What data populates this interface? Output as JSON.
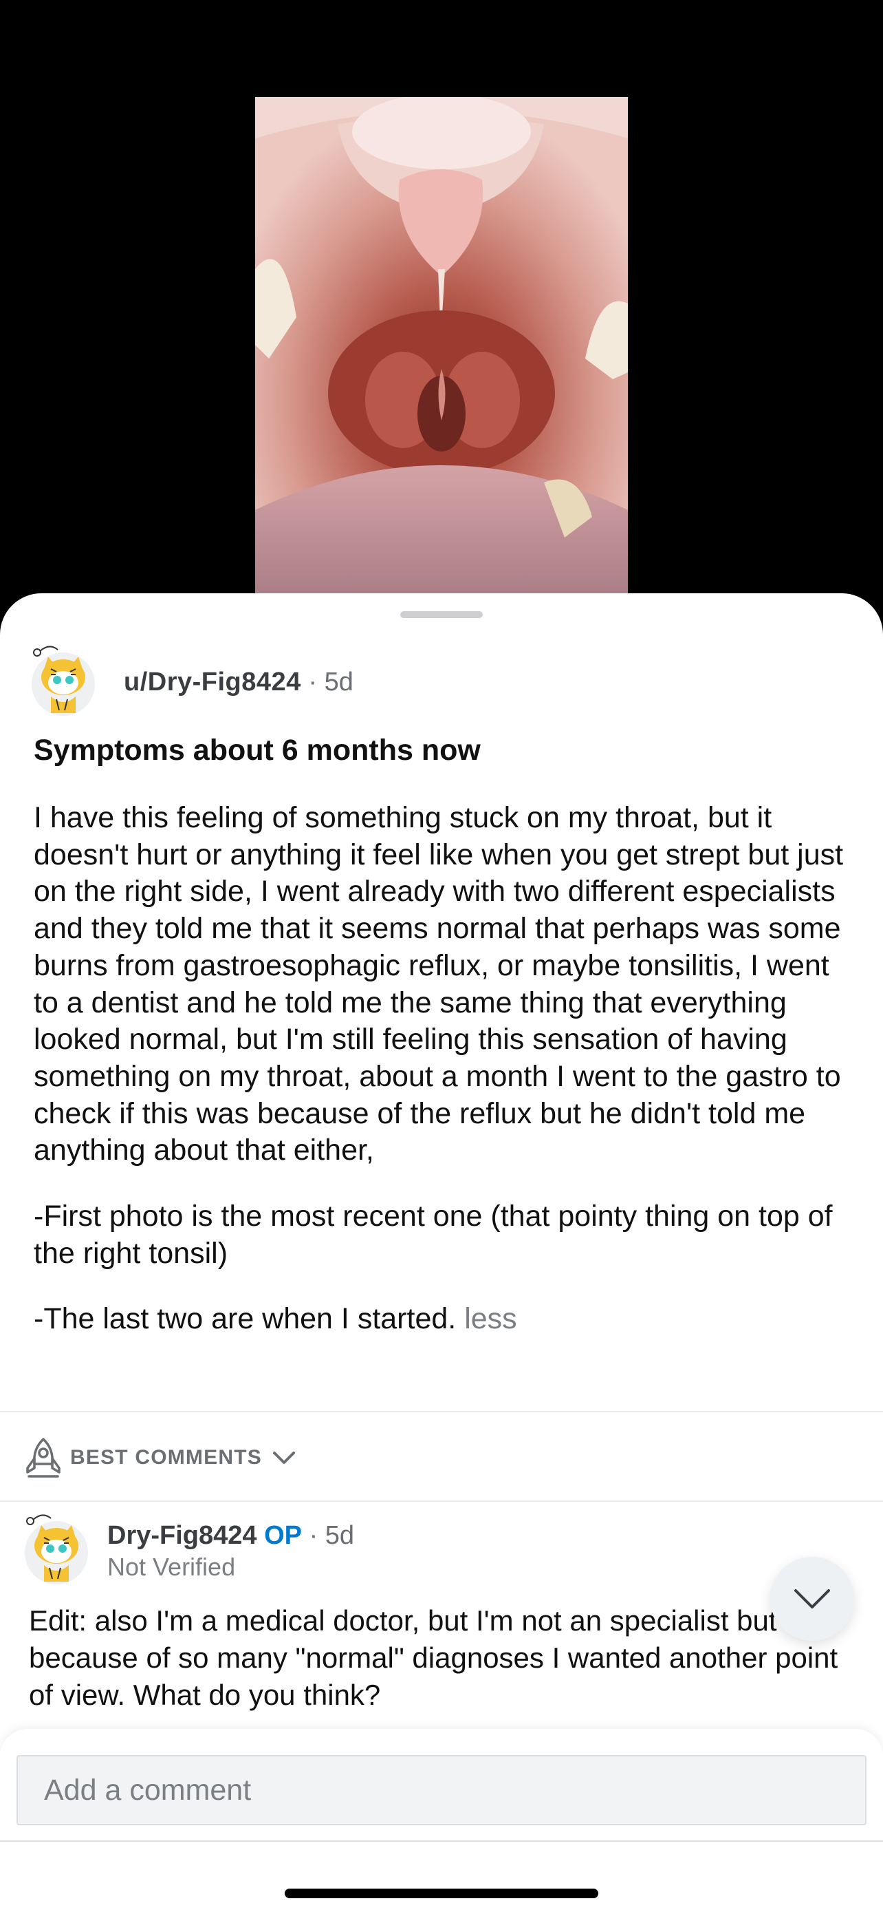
{
  "post": {
    "author": "u/Dry-Fig8424",
    "separator": "·",
    "age": "5d",
    "title": "Symptoms about 6 months now",
    "body_p1": "I have this feeling of something stuck on my throat, but it doesn't hurt or anything it feel like when you get strept but just on the right side, I went already with two different especialists and they told me that it seems normal that perhaps was some burns from gastroesophagic reflux, or maybe tonsilitis, I went to a dentist and he told me the same thing that everything looked normal, but I'm still feeling this sensation of having something on my throat, about a month I went to the gastro to check if this was because of the reflux but he didn't told me anything about that either,",
    "body_p2": "-First photo is the most recent one (that pointy thing on top of the right tonsil)",
    "body_p3": "-The last two are when I started.",
    "less_label": "less"
  },
  "comments_sort": {
    "icon": "rocket-icon",
    "label": "BEST COMMENTS",
    "chevron": "chevron-down-icon"
  },
  "comment": {
    "author": "Dry-Fig8424",
    "op_badge": "OP",
    "separator": "·",
    "age": "5d",
    "flair": "Not Verified",
    "body": "Edit: also I'm a medical doctor, but I'm not an specialist but because of so many \"normal\" diagnoses I wanted another point of view. What do you think?"
  },
  "composer": {
    "placeholder": "Add a comment"
  },
  "colors": {
    "accent_op": "#0079d3",
    "meta_text": "#6a6e73",
    "background_media": "#000000"
  }
}
